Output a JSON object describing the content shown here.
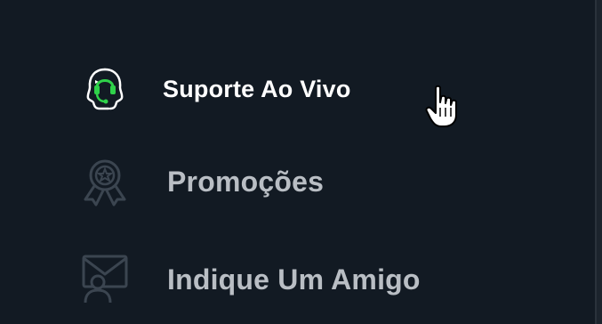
{
  "menu": {
    "items": [
      {
        "label": "Suporte Ao Vivo",
        "icon": "headset-support-icon",
        "active": true
      },
      {
        "label": "Promoções",
        "icon": "award-badge-icon",
        "active": false
      },
      {
        "label": "Indique Um Amigo",
        "icon": "invite-friend-icon",
        "active": false
      }
    ]
  },
  "colors": {
    "background": "#121a23",
    "active_text": "#ffffff",
    "inactive_text": "#b9bec4",
    "accent_green": "#2fd14a",
    "inactive_icon": "#3b4550"
  }
}
